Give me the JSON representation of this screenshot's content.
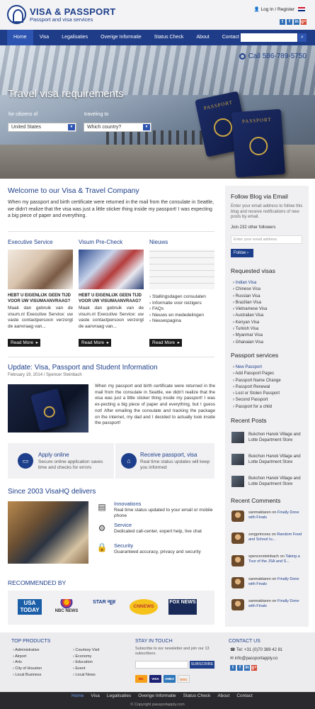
{
  "header": {
    "title": "VISA & PASSPORT",
    "subtitle": "Passport and visa services",
    "login": "Log In / Register",
    "social": [
      "t",
      "f",
      "in",
      "g+"
    ]
  },
  "nav": [
    "Home",
    "Visa",
    "Legalisaties",
    "Overige Informatie",
    "Status Check",
    "About",
    "Contact"
  ],
  "hero": {
    "call_label": "Call",
    "phone": "586-789-5750",
    "title": "Travel visa requirements",
    "citizens_label": "for citizens of",
    "traveling_label": "traveling to",
    "citizens_value": "United States",
    "traveling_value": "Which country?",
    "passport_text": "PASSPORT"
  },
  "welcome": {
    "title": "Welcome to our Visa & Travel Company",
    "text": "When my passport and birth certificate were returned in the mail from the consulate in Seattle, we didn't realize that the visa was just a little sticker thing inside my passport! I was expecting a big piece of paper and everything."
  },
  "columns": [
    {
      "title": "Executive Service",
      "subtitle": "HEBT U EIGENLIJK GEEN TIJD VOOR UW VISUMAANVRAAG?",
      "text": "Maak dan gebruik van de visum.nl Executive Service: uw vaste contactpersoon verzorgt de aanvraag van...",
      "readmore": "Read More"
    },
    {
      "title": "Visum Pre-Check",
      "subtitle": "HEBT U EIGENLIJK GEEN TIJD VOOR UW VISUMAANVRAAG?",
      "text": "Maak dan gebruik van de visum.nl Executive Service: uw vaste contactpersoon verzorgt de aanvraag van...",
      "readmore": "Read More"
    },
    {
      "title": "Nieuws",
      "items": [
        "Stallingsdagen consulaten",
        "Informatie voor reizigers",
        "FAQs",
        "Nieuws en mededelingen",
        "Nieuwspagina"
      ],
      "readmore": "Read More"
    }
  ],
  "update": {
    "title": "Update: Visa, Passport and Student Information",
    "meta": "February 19, 2014 / Spencer Steinbach",
    "text": "When my passport and birth certificate were returned in the mail from the consulate in Seattle, we didn't realize that the visa was just a little sticker thing inside my passport! I was ex-pecting a big piece of paper and everything, but I guess not! After emailing the consulate and tracking the package on the internet, my dad and I decided to actually look inside the passport!"
  },
  "apply": [
    {
      "title": "Apply online",
      "text": "Secure online application saves time and checks for errors"
    },
    {
      "title": "Receive passport, visa",
      "text": "Real time status updates will keep you informed"
    }
  ],
  "since": {
    "title": "Since 2003 VisaHQ delivers",
    "features": [
      {
        "title": "Innovations",
        "text": "Real time status updated to your email or mobile phone"
      },
      {
        "title": "Service",
        "text": "Dedicated call-center, expert help, live chat"
      },
      {
        "title": "Security",
        "text": "Guaranteed accuracy, privacy and security"
      }
    ]
  },
  "recommended": {
    "title": "RECOMMENDED BY",
    "logos": [
      "USA TODAY",
      "NBC NEWS",
      "STAR न्यूज़",
      "CNNEWS",
      "FOX NEWS"
    ]
  },
  "sidebar": {
    "follow_title": "Follow Blog via Email",
    "follow_text": "Enter your email address to follow this blog and receive notifications of new posts by email.",
    "followers": "Join 232 other followers",
    "email_placeholder": "Enter your email address",
    "follow_btn": "Follow",
    "requested_title": "Requested visas",
    "requested": [
      "Indian Visa",
      "Chinese Visa",
      "Russian Visa",
      "Brazilian Visa",
      "Vietnamese Visa",
      "Australian Visa",
      "Kenyan Visa",
      "Turkish Visa",
      "Myanmar Visa",
      "Ghanaian Visa"
    ],
    "passport_title": "Passport services",
    "passport": [
      "New Passport",
      "Add Passport Pages",
      "Passport Name Change",
      "Passport Renewal",
      "Lost or Stolen Passport",
      "Second Passport",
      "Passport for a child"
    ],
    "recent_title": "Recent Posts",
    "recent": [
      "Bukchon Hanok Village and Lotte Department Store",
      "Bukchon Hanok Village and Lotte Department Store",
      "Bukchon Hanok Village and Lotte Department Store"
    ],
    "comments_title": "Recent Comments",
    "comments": [
      {
        "user": "sanmaktaren",
        "on": "on",
        "post": "Finally Done with Finals"
      },
      {
        "user": "zergprincess",
        "on": "on",
        "post": "Random Food and School Iu..."
      },
      {
        "user": "spencersteinbach",
        "on": "on",
        "post": "Taking a Tour of the JSA and S..."
      },
      {
        "user": "sanmaktaren",
        "on": "on",
        "post": "Finally Done with Finals"
      },
      {
        "user": "sanmaktaren",
        "on": "on",
        "post": "Finally Done with Finals"
      }
    ]
  },
  "footer": {
    "products_title": "TOP PRODUCTS",
    "products_col1": [
      "Administrative",
      "Airport",
      "Arts",
      "City of Houston",
      "Local Business"
    ],
    "products_col2": [
      "Courtesy Visit",
      "Economy",
      "Education",
      "Event",
      "Local News"
    ],
    "stay_title": "STAY IN TOUCH",
    "stay_text": "Subscribe to our newsletter and join our 13 subscribers.",
    "subscribe_btn": "SUBSCRIBE",
    "contact_title": "CONTACT US",
    "tel": "Tel: +31 (0)70 389 42 81",
    "email": "info@passportapply.co",
    "cards": [
      "MC",
      "VISA",
      "AMEX",
      "DISC"
    ]
  },
  "bottom_nav": [
    "Home",
    "Visa",
    "Legalisaties",
    "Overige Informatie",
    "Status Check",
    "About",
    "Contact"
  ],
  "copyright": "© Copyright passportapply.com"
}
